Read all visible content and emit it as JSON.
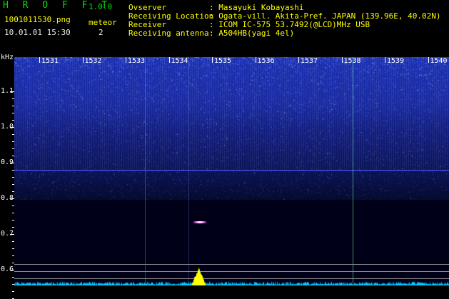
{
  "app": {
    "title": "H R O F F T",
    "version": "1.0.0"
  },
  "file": {
    "name": "1001011530.png",
    "datetime": "10.01.01 15:30"
  },
  "meteor": {
    "label": "meteor",
    "count": "2"
  },
  "info": [
    {
      "key": "Ovserver",
      "value": ": Masayuki Kobayashi"
    },
    {
      "key": "Receiving Location",
      "value": ": Ogata-vill. Akita-Pref. JAPAN (139.96E, 40.02N)"
    },
    {
      "key": "Receiver",
      "value": ": ICOM IC-575 53.7492(@LCD)MHz USB"
    },
    {
      "key": "Receiving antenna",
      "value": ": A504HB(yagi 4el)"
    }
  ],
  "axis": {
    "y_unit": "kHz",
    "time_ticks": [
      "1531",
      "1532",
      "1533",
      "1534",
      "1535",
      "1536",
      "1537",
      "1538",
      "1539",
      "1540"
    ],
    "freq_ticks": [
      "1.1",
      "1.0",
      "0.9",
      "0.8",
      "0.7",
      "0.6"
    ]
  },
  "colors": {
    "background": "#000000",
    "accent": "#00e000",
    "noise": "#2a3ec8",
    "meteor_line": "#5060ff",
    "spectrum": "#00c8ff",
    "peak": "#ffff00"
  }
}
